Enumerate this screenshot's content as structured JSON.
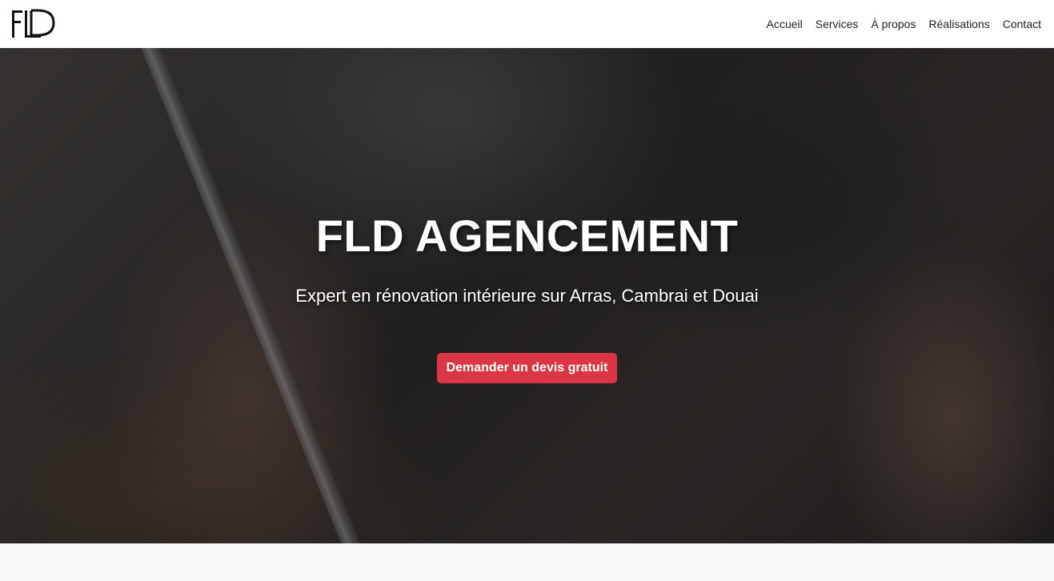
{
  "navbar": {
    "logo_text": "FLD",
    "links": [
      {
        "label": "Accueil"
      },
      {
        "label": "Services"
      },
      {
        "label": "À propos"
      },
      {
        "label": "Réalisations"
      },
      {
        "label": "Contact"
      }
    ]
  },
  "hero": {
    "title": "FLD AGENCEMENT",
    "subtitle": "Expert en rénovation intérieure sur Arras, Cambrai et Douai",
    "cta_label": "Demander un devis gratuit",
    "cta_color": "#dc3545",
    "background_description_icon": "hand-writing-with-pen-photo"
  }
}
